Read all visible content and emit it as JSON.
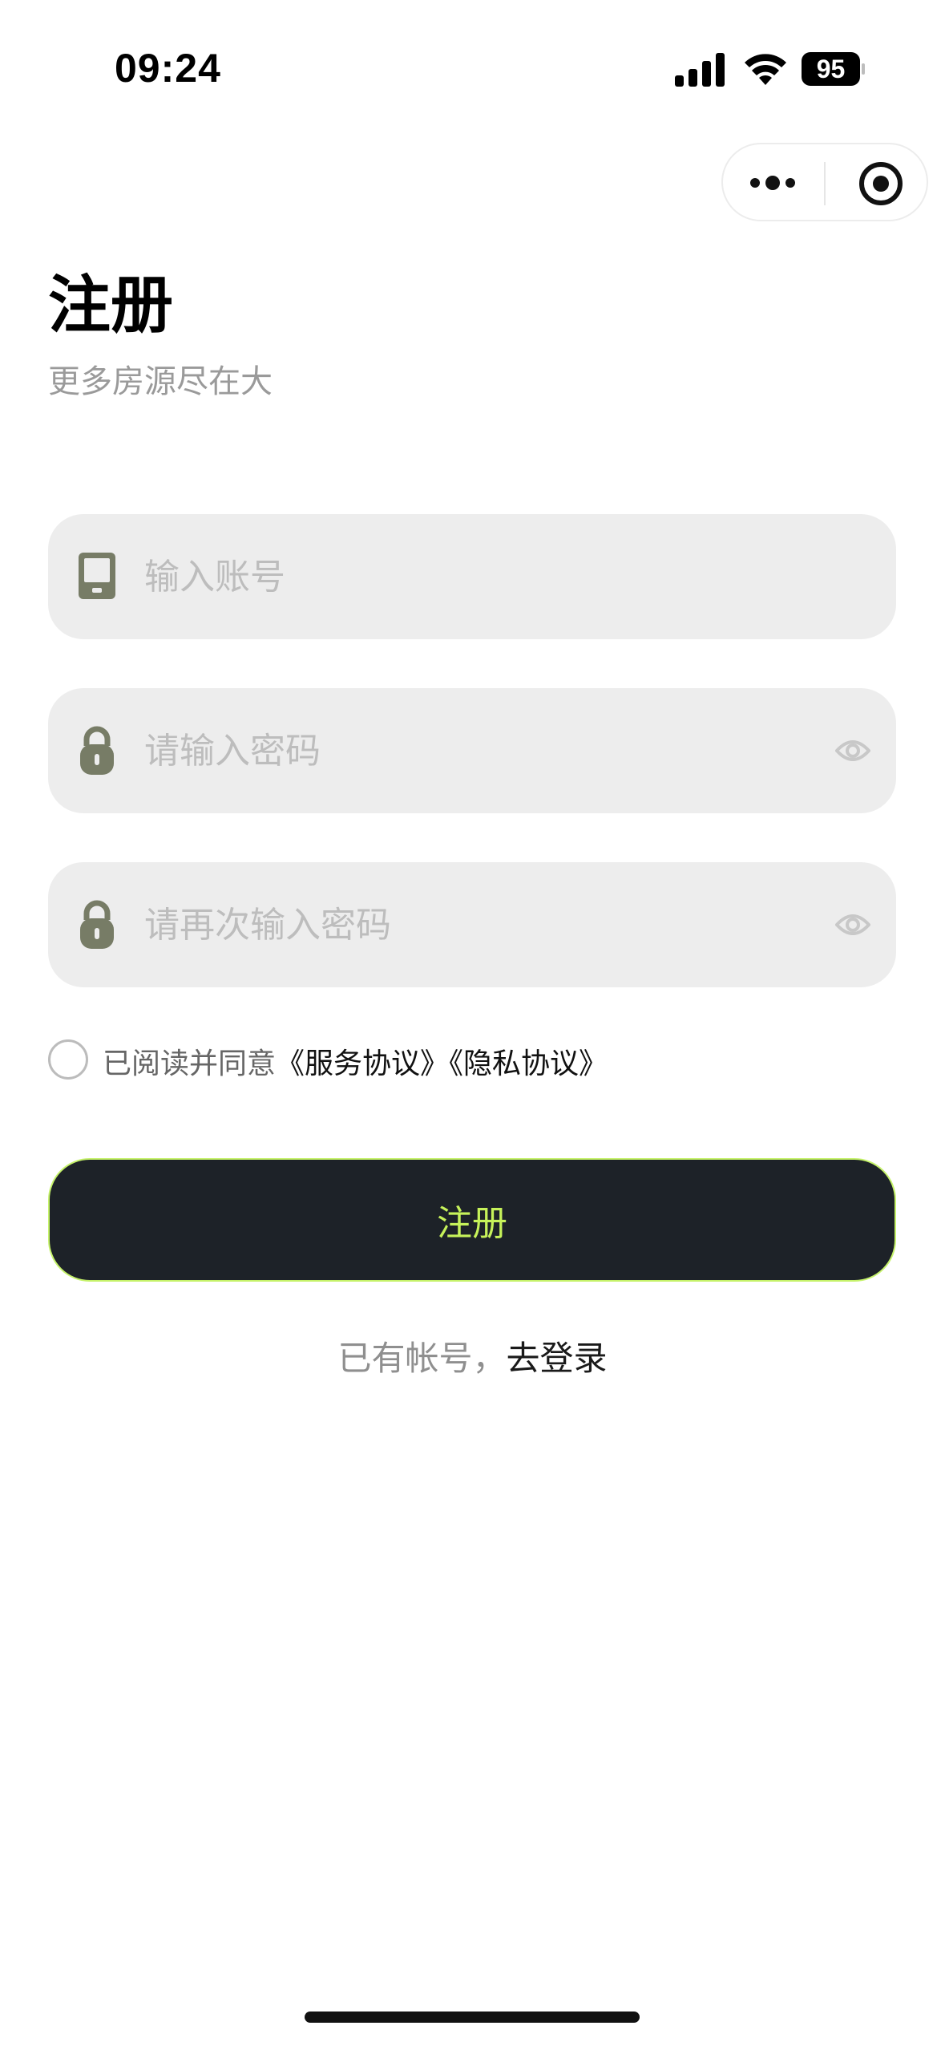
{
  "status_bar": {
    "time": "09:24",
    "battery": "95",
    "icons": [
      "signal-icon",
      "wifi-icon",
      "battery-icon"
    ]
  },
  "capsule": {
    "icons": [
      "more-icon",
      "close-target-icon"
    ]
  },
  "header": {
    "title": "注册",
    "subtitle": "更多房源尽在大"
  },
  "form": {
    "account_placeholder": "输入账号",
    "password_placeholder": "请输入密码",
    "confirm_password_placeholder": "请再次输入密码",
    "icons": {
      "account": "phone-icon",
      "password": "lock-icon",
      "visibility": "eye-icon"
    }
  },
  "agreement": {
    "prefix": "已阅读并同意",
    "service_link": "《服务协议》",
    "privacy_link": "《隐私协议》",
    "checked": false
  },
  "submit": {
    "label": "注册"
  },
  "login": {
    "prompt": "已有帐号，",
    "link": "去登录"
  },
  "colors": {
    "icon": "#777c66",
    "button_bg": "#1d2228",
    "button_text": "#c6f25a",
    "input_bg": "#ededed"
  }
}
